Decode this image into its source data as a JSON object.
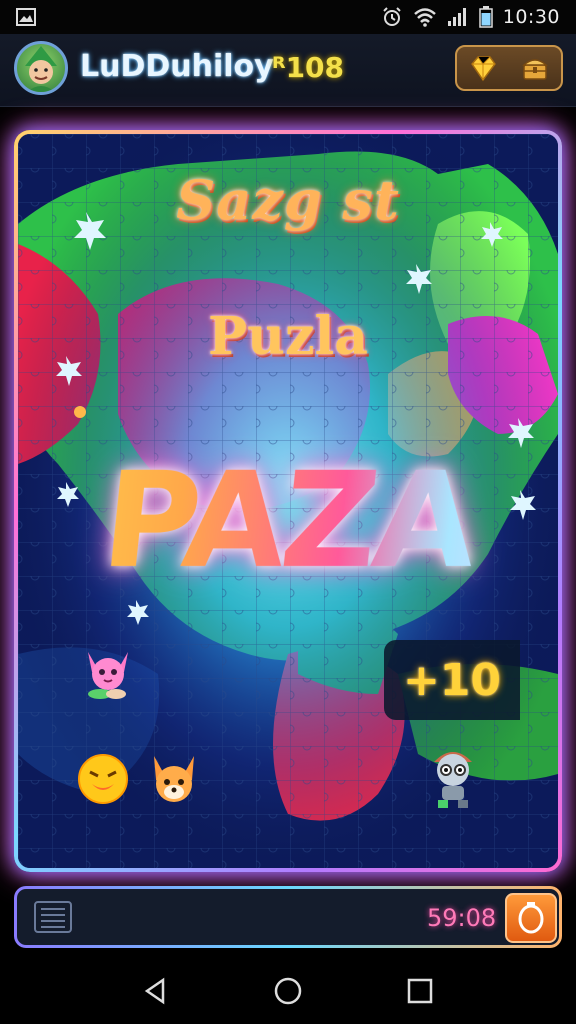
{
  "status_bar": {
    "time": "10:30",
    "icons": [
      "gallery-icon",
      "alarm-icon",
      "wifi-icon",
      "signal-icon",
      "battery-icon"
    ]
  },
  "header": {
    "username": "LuDDuhiloy",
    "score": "ᴿ108",
    "buttons": [
      "gem-icon",
      "treasure-chest-icon"
    ]
  },
  "board": {
    "title_line1": "Sazg st",
    "title_line2": "Puzla",
    "logo": "PAZA",
    "bonus": "+10",
    "characters": [
      "pink-cat-icon",
      "yellow-smiley-icon",
      "orange-fox-icon",
      "robot-kid-icon"
    ]
  },
  "bottom_bar": {
    "timer": "59:08",
    "buttons": [
      "menu-icon",
      "timer-button-icon"
    ]
  },
  "nav": {
    "buttons": [
      "back-icon",
      "home-icon",
      "recents-icon"
    ]
  },
  "colors": {
    "board_bg": "#0b1640",
    "accent_gold": "#ffd23a",
    "accent_pink": "#ff58c8",
    "timer_pink": "#ff7ab8",
    "button_orange": "#ff9a3a"
  }
}
